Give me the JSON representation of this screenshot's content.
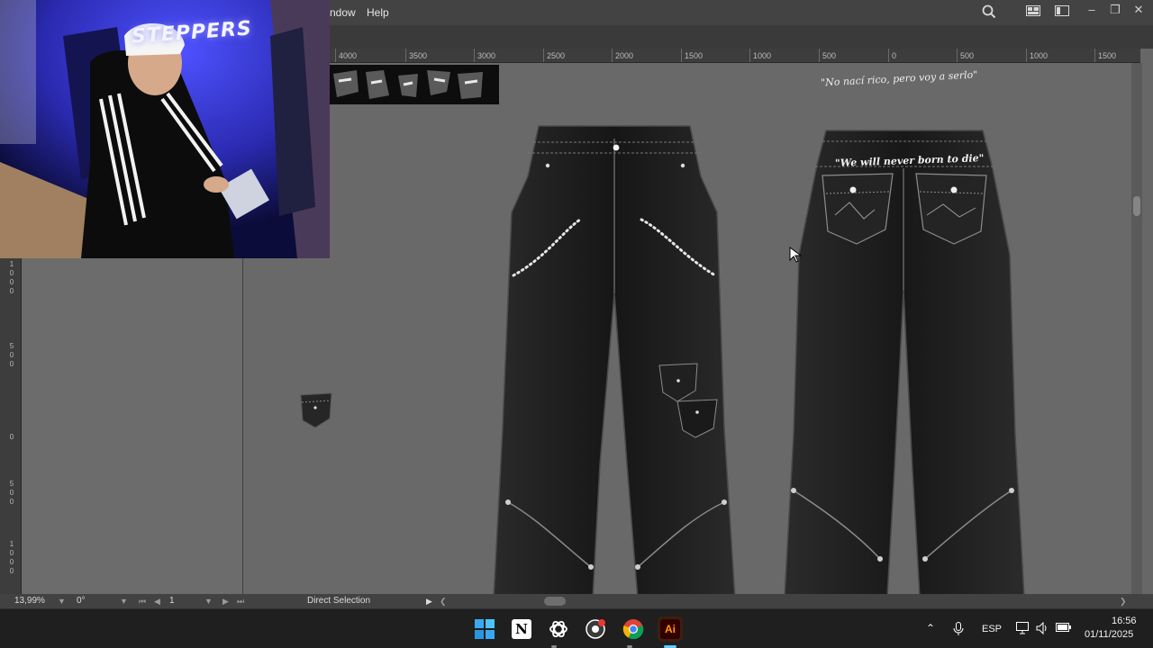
{
  "menubar": {
    "items": [
      "ndow",
      "Help"
    ]
  },
  "hruler": {
    "ticks": [
      "4000",
      "3500",
      "3000",
      "2500",
      "2000",
      "1500",
      "1000",
      "500",
      "0",
      "500",
      "1000",
      "1500"
    ]
  },
  "vruler": {
    "labels": [
      "1\n0\n0\n0",
      "5\n0\n0",
      "0",
      "5\n0\n0",
      "1\n0\n0\n0"
    ]
  },
  "statusbar": {
    "zoom": "13,99%",
    "rotation": "0°",
    "artboard": "1",
    "tool": "Direct Selection"
  },
  "artwork": {
    "slogan_top": "\"No nací rico, pero voy a serlo\"",
    "slogan_back": "\"We will never born to die\""
  },
  "webcam": {
    "banner_text": "STEPPERS"
  },
  "taskbar": {
    "apps": [
      "windows-start",
      "notion",
      "chatgpt",
      "chrome-profile",
      "chrome",
      "illustrator"
    ],
    "language": "ESP",
    "time": "16:56",
    "date": "01/11/2025",
    "illustrator_label": "Ai",
    "notion_label": "N"
  },
  "icons": {
    "search": "search-icon",
    "panels": "panels-icon",
    "arrange": "arrange-documents-icon"
  },
  "colors": {
    "denim": "#1d1d1d",
    "stitch": "#d8d8d8",
    "canvas": "#696969",
    "ai_orange": "#ff9a00",
    "ai_bg": "#330000"
  }
}
